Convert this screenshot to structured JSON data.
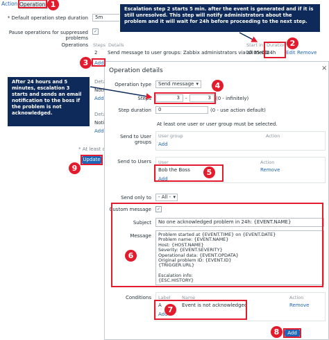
{
  "tabs": [
    "Action",
    "Operations"
  ],
  "bg": {
    "default_duration_label": "* Default operation step duration",
    "default_duration_value": "5m",
    "pause_label": "Pause operations for suppressed problems",
    "operations_label": "Operations",
    "steps_header": "Steps",
    "details_header": "Details",
    "start_in_header": "Start in",
    "duration_header": "Duration",
    "op_step": "2",
    "op_details": "Send message to user groups: Zabbix administrators via all media",
    "op_start_in": "00:05:00",
    "op_duration": "24h",
    "edit_link": "Edit",
    "remove_link": "Remove",
    "add_link": "Add",
    "at_least_one": "* At least one",
    "update_button": "Update",
    "partial_labels": [
      "Detail",
      "Notify",
      "Add",
      "Detail",
      "Notify",
      "Add"
    ]
  },
  "notes": {
    "note1": "Escalation step 2 starts 5 min. after the event is generated and if it is still unresolved. This step will notify administrators about the problem and it will wait for 24h before proceeding to the next step.",
    "note2": "After 24 hours and 5 minutes, escalation 3 starts and sends an email notification to the boss if the problem is not acknowledged."
  },
  "markers": [
    "1",
    "2",
    "3",
    "4",
    "5",
    "6",
    "7",
    "8",
    "9"
  ],
  "dialog": {
    "title": "Operation details",
    "operation_type_label": "Operation type",
    "operation_type_value": "Send message",
    "steps_label": "Steps",
    "steps_from": "3",
    "steps_dash": "-",
    "steps_to": "3",
    "steps_hint": "(0 - infinitely)",
    "step_duration_label": "Step duration",
    "step_duration_value": "0",
    "step_duration_hint": "(0 - use action default)",
    "warning": "At least one user or user group must be selected.",
    "send_groups_label": "Send to User groups",
    "user_group_header": "User group",
    "action_header": "Action",
    "add_link": "Add",
    "send_users_label": "Send to Users",
    "user_header": "User",
    "user_name": "Bob the Boss",
    "remove_link": "Remove",
    "send_only_label": "Send only to",
    "send_only_value": "- All -",
    "custom_message_label": "Custom message",
    "subject_label": "Subject",
    "subject_value": "No one acknowledged problem in 24h: {EVENT.NAME}",
    "message_label": "Message",
    "message_lines": [
      "Problem started at {EVENT.TIME} on {EVENT.DATE}",
      "Problem name: {EVENT.NAME}",
      "Host: {HOST.NAME}",
      "Severity: {EVENT.SEVERITY}",
      "Operational data: {EVENT.OPDATA}",
      "Original problem ID: {EVENT.ID}",
      "{TRIGGER.URL}",
      "",
      "Escalation info:",
      "{ESC.HISTORY}"
    ],
    "conditions_label": "Conditions",
    "label_header": "Label",
    "name_header": "Name",
    "cond_label": "A",
    "cond_name": "Event is not acknowledged",
    "add_button": "Add"
  }
}
